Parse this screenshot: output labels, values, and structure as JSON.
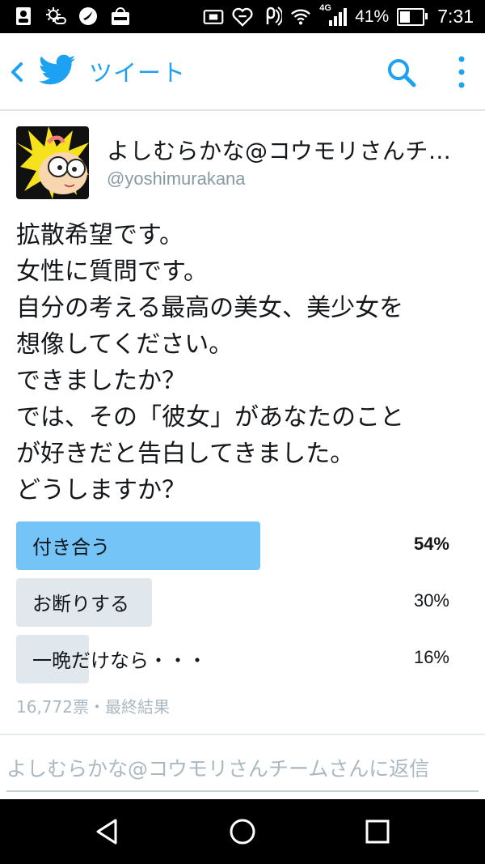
{
  "status_bar": {
    "network": "4G",
    "battery_percent": "41%",
    "time": "7:31",
    "left_icons": [
      "contact-card-icon",
      "weather-icon",
      "app-icon",
      "market-icon"
    ]
  },
  "header": {
    "title": "ツイート",
    "accent_color": "#1da1f2"
  },
  "tweet": {
    "display_name": "よしむらかな@コウモリさんチ…",
    "handle": "@yoshimurakana",
    "lines": [
      "拡散希望です。",
      "女性に質問です。",
      "自分の考える最高の美女、美少女を",
      "想像してください。",
      "できましたか？",
      "では、その「彼女」があなたのこと",
      "が好きだと告白してきました。",
      "どうしますか？"
    ]
  },
  "poll": {
    "options": [
      {
        "label": "付き合う",
        "percent": "54%",
        "fraction": 0.54,
        "leading": true
      },
      {
        "label": "お断りする",
        "percent": "30%",
        "fraction": 0.3,
        "leading": false
      },
      {
        "label": "一晩だけなら・・・",
        "percent": "16%",
        "fraction": 0.16,
        "leading": false
      }
    ],
    "meta": "16,772票・最終結果",
    "leading_color": "#75c4f8",
    "other_color": "#e1e8ed"
  },
  "reply": {
    "placeholder": "よしむらかな@コウモリさんチームさんに返信"
  }
}
